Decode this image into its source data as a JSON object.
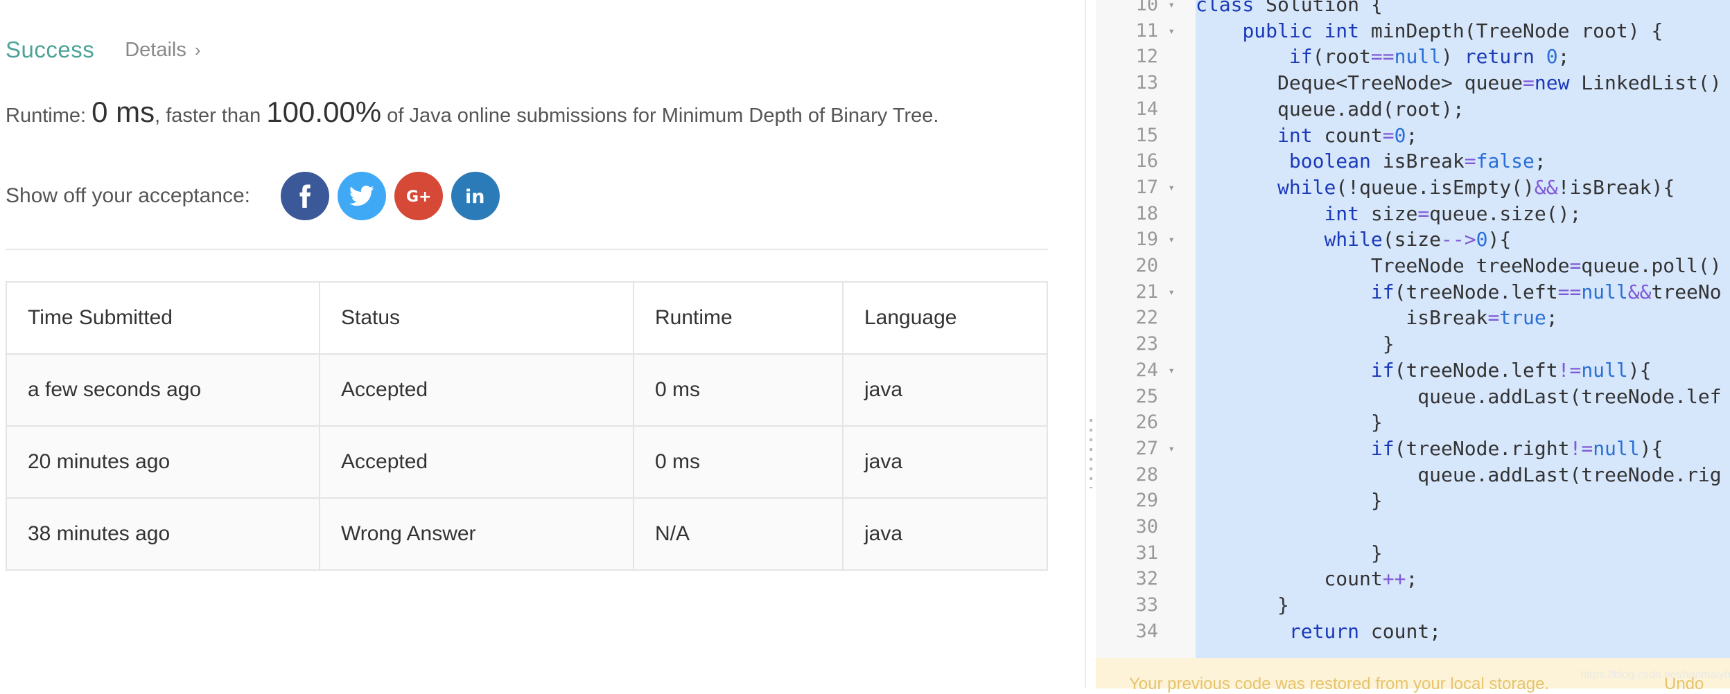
{
  "result": {
    "status": "Success",
    "details_label": "Details",
    "runtime_prefix": "Runtime: ",
    "runtime_value": "0 ms",
    "faster_text": ", faster than ",
    "percent": "100.00%",
    "suffix": " of Java online submissions for Minimum Depth of Binary Tree."
  },
  "share": {
    "label": "Show off your acceptance:",
    "icons": [
      "facebook-icon",
      "twitter-icon",
      "google-plus-icon",
      "linkedin-icon"
    ]
  },
  "table": {
    "headers": [
      "Time Submitted",
      "Status",
      "Runtime",
      "Language"
    ],
    "rows": [
      {
        "time": "a few seconds ago",
        "status": "Accepted",
        "runtime": "0 ms",
        "language": "java"
      },
      {
        "time": "20 minutes ago",
        "status": "Accepted",
        "runtime": "0 ms",
        "language": "java"
      },
      {
        "time": "38 minutes ago",
        "status": "Wrong Answer",
        "runtime": "N/A",
        "language": "java"
      }
    ]
  },
  "editor": {
    "lines": [
      {
        "n": "10",
        "fold": true,
        "code": "class Solution {"
      },
      {
        "n": "11",
        "fold": true,
        "code": "    public int minDepth(TreeNode root) {"
      },
      {
        "n": "12",
        "fold": false,
        "code": "        if(root==null) return 0;"
      },
      {
        "n": "13",
        "fold": false,
        "code": "       Deque<TreeNode> queue=new LinkedList()"
      },
      {
        "n": "14",
        "fold": false,
        "code": "       queue.add(root);"
      },
      {
        "n": "15",
        "fold": false,
        "code": "       int count=0;"
      },
      {
        "n": "16",
        "fold": false,
        "code": "        boolean isBreak=false;"
      },
      {
        "n": "17",
        "fold": true,
        "code": "       while(!queue.isEmpty()&&!isBreak){"
      },
      {
        "n": "18",
        "fold": false,
        "code": "           int size=queue.size();"
      },
      {
        "n": "19",
        "fold": true,
        "code": "           while(size-->0){"
      },
      {
        "n": "20",
        "fold": false,
        "code": "               TreeNode treeNode=queue.poll()"
      },
      {
        "n": "21",
        "fold": true,
        "code": "               if(treeNode.left==null&&treeNo"
      },
      {
        "n": "22",
        "fold": false,
        "code": "                  isBreak=true;"
      },
      {
        "n": "23",
        "fold": false,
        "code": "                }"
      },
      {
        "n": "24",
        "fold": true,
        "code": "               if(treeNode.left!=null){"
      },
      {
        "n": "25",
        "fold": false,
        "code": "                   queue.addLast(treeNode.lef"
      },
      {
        "n": "26",
        "fold": false,
        "code": "               }"
      },
      {
        "n": "27",
        "fold": true,
        "code": "               if(treeNode.right!=null){"
      },
      {
        "n": "28",
        "fold": false,
        "code": "                   queue.addLast(treeNode.rig"
      },
      {
        "n": "29",
        "fold": false,
        "code": "               }"
      },
      {
        "n": "30",
        "fold": false,
        "code": ""
      },
      {
        "n": "31",
        "fold": false,
        "code": "               }"
      },
      {
        "n": "32",
        "fold": false,
        "code": "           count++;"
      },
      {
        "n": "33",
        "fold": false,
        "code": "       }"
      },
      {
        "n": "34",
        "fold": false,
        "code": "        return count;"
      }
    ],
    "restore_message": "Your previous code was restored from your local storage.",
    "undo_label": "Undo"
  },
  "watermark": "https://blog.csdn.net/hanmaiyhai"
}
